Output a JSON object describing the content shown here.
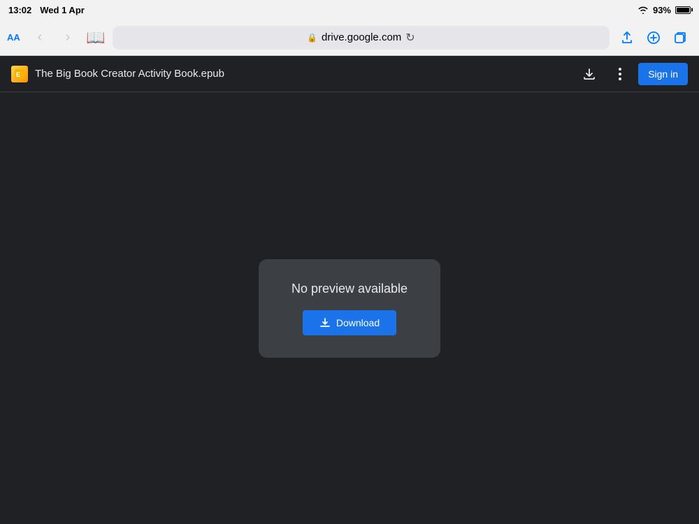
{
  "status_bar": {
    "time": "13:02",
    "date": "Wed 1 Apr",
    "wifi_label": "wifi",
    "battery_percent": "93%"
  },
  "nav_bar": {
    "aa_label": "AA",
    "url": "drive.google.com",
    "lock_symbol": "🔒",
    "back_icon": "‹",
    "forward_icon": "›",
    "book_icon": "📖",
    "share_icon": "⬆",
    "plus_icon": "+",
    "tabs_icon": "⧉",
    "reload_icon": "↻"
  },
  "drive_toolbar": {
    "file_icon_label": "📄",
    "file_name": "The Big Book Creator Activity Book.epub",
    "download_icon": "⬇",
    "more_icon": "⋮",
    "sign_in_label": "Sign in"
  },
  "preview_card": {
    "no_preview_text": "No preview available",
    "download_button_label": "Download",
    "download_icon": "⬇"
  }
}
